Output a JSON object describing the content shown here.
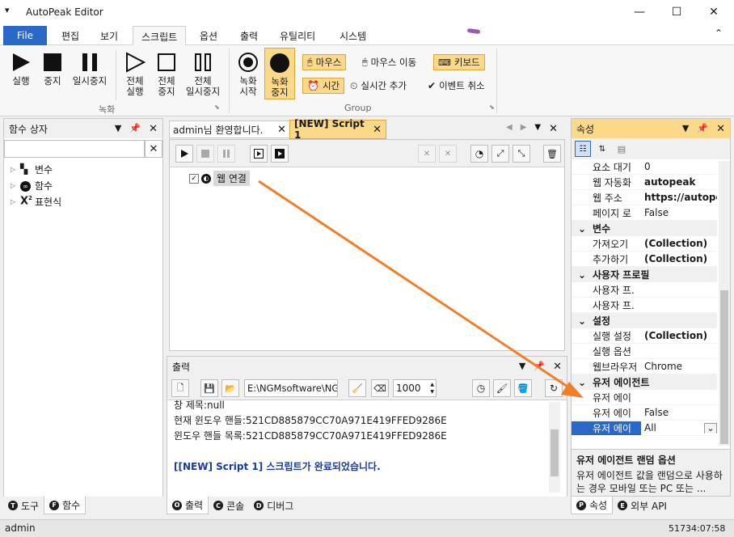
{
  "window": {
    "title": "AutoPeak Editor",
    "menu_glyph": "▾",
    "minimize": "—",
    "maximize": "☐",
    "close": "✕"
  },
  "menu": {
    "file": "File",
    "tabs": [
      "편집",
      "보기",
      "스크립트",
      "옵션",
      "출력",
      "유틸리티",
      "시스템"
    ],
    "active": "스크립트",
    "collapse": "⌃"
  },
  "ribbon": {
    "record_group": {
      "label": "녹화",
      "buttons": [
        "실행",
        "중지",
        "일시중지",
        "전체\n실행",
        "전체\n중지",
        "전체\n일시중지"
      ]
    },
    "group2": {
      "label": "Group",
      "buttons": [
        "녹화\n시작",
        "녹화\n중지"
      ],
      "chips": [
        "마우스",
        "마우스 이동",
        "키보드",
        "시간",
        "실시간 추가",
        "이벤트 취소"
      ]
    }
  },
  "left_panel": {
    "title": "함수 상자",
    "search_placeholder": "",
    "clear": "✕",
    "items": [
      "변수",
      "함수",
      "표현식"
    ],
    "tabs": [
      "도구",
      "함수"
    ],
    "tab_icons": [
      "T",
      "F"
    ]
  },
  "editor": {
    "tabs": [
      "admin님 환영합니다.",
      "[NEW] Script 1"
    ],
    "active_tab": "[NEW] Script 1",
    "node_label": "웹 연결"
  },
  "output": {
    "title": "출력",
    "path": "E:\\NGMsoftware\\NG",
    "count": "1000",
    "lines": [
      "창 제목:null",
      "현재 윈도우 핸들:521CD885879CC70A971E419FFED9286E",
      "윈도우 핸들 목록:521CD885879CC70A971E419FFED9286E",
      "",
      "[[NEW] Script 1] 스크립트가 완료되었습니다."
    ],
    "tabs": [
      "출력",
      "콘솔",
      "디버그"
    ],
    "tab_icons": [
      "O",
      "C",
      "D"
    ]
  },
  "properties": {
    "title": "속성",
    "rows": [
      {
        "type": "prop",
        "k": "요소 대기",
        "v": "0",
        "bold": false
      },
      {
        "type": "prop",
        "k": "웹 자동화",
        "v": "autopeak",
        "bold": true
      },
      {
        "type": "prop",
        "k": "웹 주소",
        "v": "https://autopeak",
        "bold": true
      },
      {
        "type": "prop",
        "k": "페이지 로",
        "v": "False",
        "bold": false
      },
      {
        "type": "cat",
        "k": "변수"
      },
      {
        "type": "prop",
        "k": "가져오기",
        "v": "(Collection)",
        "bold": true
      },
      {
        "type": "prop",
        "k": "추가하기",
        "v": "(Collection)",
        "bold": true
      },
      {
        "type": "cat",
        "k": "사용자 프로필"
      },
      {
        "type": "prop",
        "k": "사용자 프.",
        "v": "",
        "bold": false
      },
      {
        "type": "prop",
        "k": "사용자 프.",
        "v": "",
        "bold": false
      },
      {
        "type": "cat",
        "k": "설정"
      },
      {
        "type": "prop",
        "k": "실행 설정",
        "v": "(Collection)",
        "bold": true
      },
      {
        "type": "prop",
        "k": "실행 옵션",
        "v": "",
        "bold": false
      },
      {
        "type": "prop",
        "k": "웹브라우저",
        "v": "Chrome",
        "bold": false
      },
      {
        "type": "cat",
        "k": "유저 에이전트"
      },
      {
        "type": "prop",
        "k": "유저 에이",
        "v": "",
        "bold": false
      },
      {
        "type": "prop",
        "k": "유저 에이",
        "v": "False",
        "bold": false
      },
      {
        "type": "sel",
        "k": "유저 에이",
        "v": "All",
        "bold": false
      }
    ],
    "desc_title": "유저 에이전트 랜덤 옵션",
    "desc_text": "유저 에이전트 값을 랜덤으로 사용하는 경우 모바일 또는 PC 또는 ...",
    "tabs": [
      "속성",
      "외부 API"
    ],
    "tab_icons": [
      "P",
      "E"
    ]
  },
  "status": {
    "user": "admin",
    "time": "51734:07:58"
  },
  "colors": {
    "accent": "#2a68c7",
    "highlight": "#fbd98a",
    "arrow": "#f07f2a",
    "link_blue": "#1a3aa0"
  }
}
